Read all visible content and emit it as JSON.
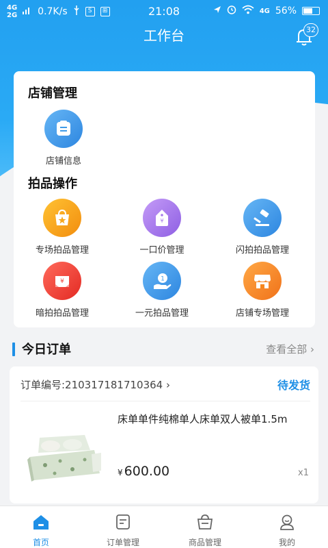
{
  "status_bar": {
    "net1": "4G",
    "net2": "2G",
    "speed": "0.7K/s",
    "time": "21:08",
    "net3": "4G",
    "battery": "56%"
  },
  "header": {
    "title": "工作台",
    "notification_count": "32"
  },
  "shop_management": {
    "title": "店铺管理",
    "items": [
      {
        "label": "店铺信息",
        "icon": "shop-info-icon",
        "color": "#3f9be8"
      }
    ]
  },
  "auction_ops": {
    "title": "拍品操作",
    "items": [
      {
        "label": "专场拍品管理",
        "icon": "special-auction-icon",
        "color": "#f7a81d"
      },
      {
        "label": "一口价管理",
        "icon": "fixed-price-icon",
        "color": "#a77bea"
      },
      {
        "label": "闪拍拍品管理",
        "icon": "flash-auction-icon",
        "color": "#3f9be8"
      },
      {
        "label": "暗拍拍品管理",
        "icon": "sealed-auction-icon",
        "color": "#f0433a"
      },
      {
        "label": "一元拍品管理",
        "icon": "one-yuan-auction-icon",
        "color": "#3f9be8"
      },
      {
        "label": "店铺专场管理",
        "icon": "shop-special-icon",
        "color": "#f7861d"
      }
    ]
  },
  "today_orders": {
    "title": "今日订单",
    "view_all": "查看全部 ›",
    "order": {
      "number": "订单编号:210317181710364 ›",
      "status": "待发货",
      "product_name": "床单单件纯棉单人床单双人被单1.5m",
      "currency": "¥",
      "price": "600.00",
      "quantity": "x1"
    }
  },
  "tabs": [
    {
      "label": "首页",
      "icon": "home-icon",
      "active": true
    },
    {
      "label": "订单管理",
      "icon": "orders-icon",
      "active": false
    },
    {
      "label": "商品管理",
      "icon": "goods-icon",
      "active": false
    },
    {
      "label": "我的",
      "icon": "profile-icon",
      "active": false
    }
  ],
  "colors": {
    "accent": "#1e8fe6",
    "header_blue": "#22a0f0"
  }
}
